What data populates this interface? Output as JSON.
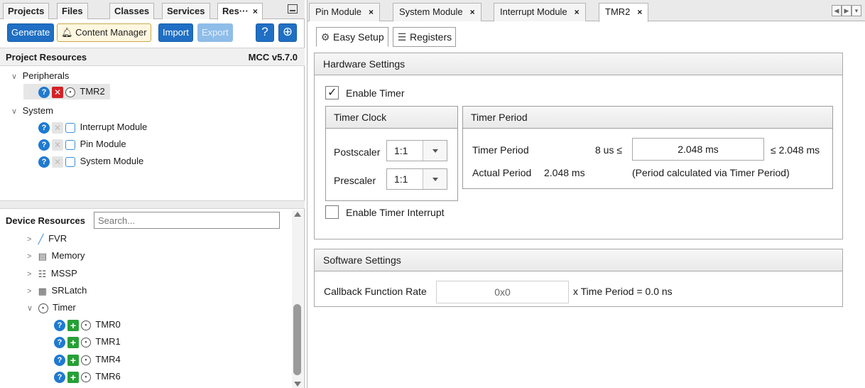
{
  "left_tabs": [
    {
      "label": "Projects"
    },
    {
      "label": "Files"
    },
    {
      "label": "Classes"
    },
    {
      "label": "Services"
    },
    {
      "label": "Res···",
      "close": "×"
    }
  ],
  "toolbar": {
    "generate": "Generate",
    "content_manager": "Content Manager",
    "import": "Import",
    "export": "Export"
  },
  "project_resources": {
    "title": "Project Resources",
    "version": "MCC v5.7.0",
    "peripherals_label": "Peripherals",
    "peripherals": [
      {
        "label": "TMR2"
      }
    ],
    "system_label": "System",
    "system": [
      {
        "label": "Interrupt Module"
      },
      {
        "label": "Pin Module"
      },
      {
        "label": "System Module"
      }
    ]
  },
  "device_resources": {
    "title": "Device Resources",
    "search_placeholder": "Search...",
    "items": [
      {
        "label": "FVR",
        "icon": "fvr-icon"
      },
      {
        "label": "Memory",
        "icon": "memory-icon"
      },
      {
        "label": "MSSP",
        "icon": "mssp-icon"
      },
      {
        "label": "SRLatch",
        "icon": "srlatch-icon"
      },
      {
        "label": "Timer",
        "icon": "timer-icon"
      }
    ],
    "timer_children": [
      {
        "label": "TMR0"
      },
      {
        "label": "TMR1"
      },
      {
        "label": "TMR4"
      },
      {
        "label": "TMR6"
      }
    ]
  },
  "editor_tabs": [
    {
      "label": "Pin Module",
      "close": "×"
    },
    {
      "label": "System Module",
      "close": "×"
    },
    {
      "label": "Interrupt Module",
      "close": "×"
    },
    {
      "label": "TMR2",
      "close": "×"
    }
  ],
  "sub_tabs": {
    "easy_setup": "Easy Setup",
    "registers": "Registers"
  },
  "hardware": {
    "title": "Hardware Settings",
    "enable_timer": "Enable Timer",
    "enable_timer_checked": true,
    "timer_clock": {
      "title": "Timer Clock",
      "postscaler_label": "Postscaler",
      "postscaler_value": "1:1",
      "prescaler_label": "Prescaler",
      "prescaler_value": "1:1"
    },
    "timer_period": {
      "title": "Timer Period",
      "label": "Timer Period",
      "min": "8 us ≤",
      "value": "2.048 ms",
      "max": "≤ 2.048 ms",
      "actual_label": "Actual Period",
      "actual_value": "2.048 ms",
      "note": "(Period calculated via Timer Period)"
    },
    "enable_interrupt": "Enable Timer Interrupt",
    "enable_interrupt_checked": false
  },
  "software": {
    "title": "Software Settings",
    "callback_label": "Callback Function Rate",
    "callback_value": "0x0",
    "suffix": "x Time Period = 0.0 ns"
  },
  "colors": {
    "accent": "#1f6fc4",
    "remove": "#d32128",
    "add": "#27a036"
  }
}
